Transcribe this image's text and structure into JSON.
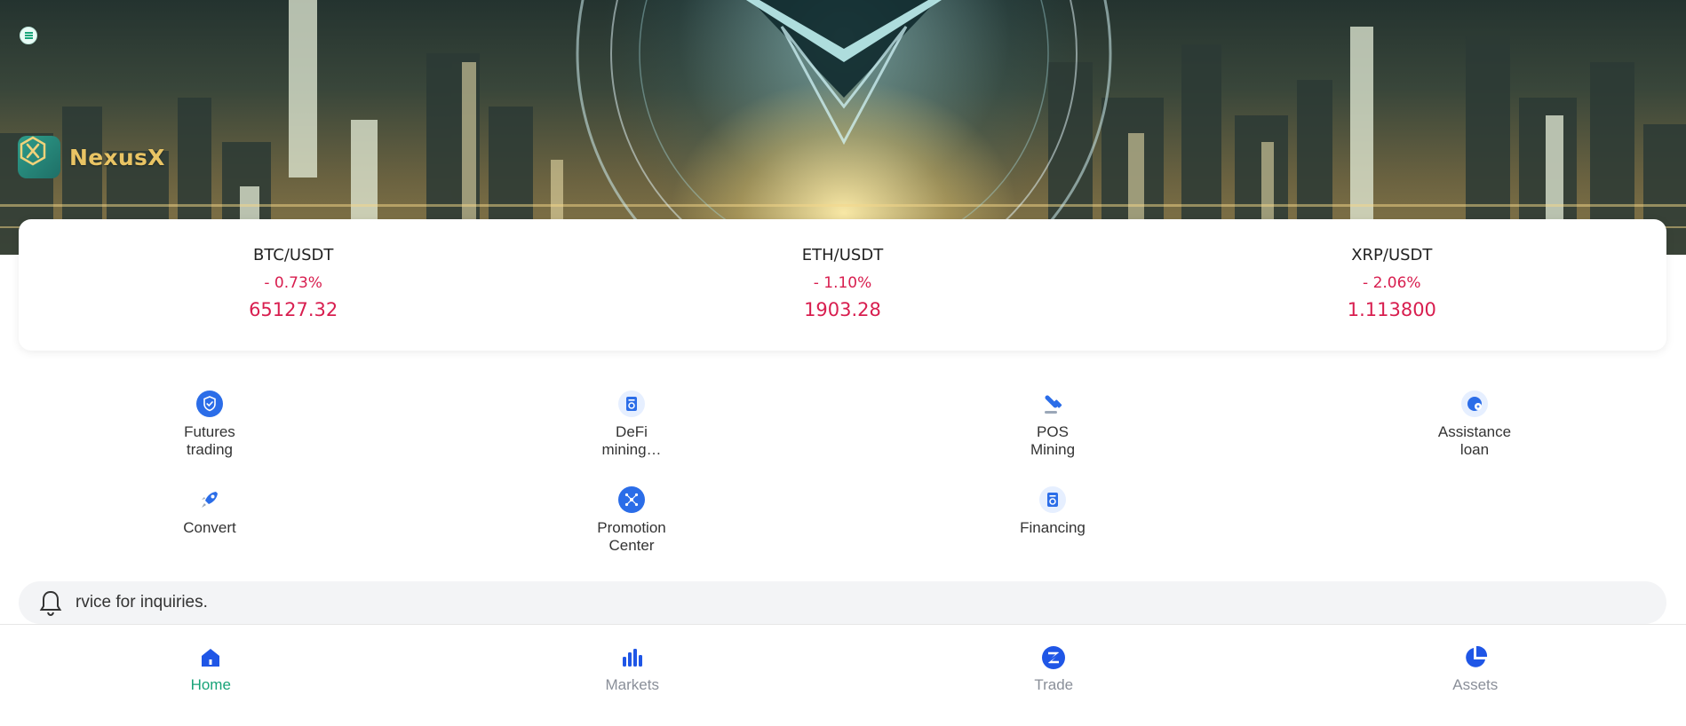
{
  "brand": {
    "name": "NexusX"
  },
  "tickers": [
    {
      "pair": "BTC/USDT",
      "change": "- 0.73%",
      "price": "65127.32"
    },
    {
      "pair": "ETH/USDT",
      "change": "- 1.10%",
      "price": "1903.28"
    },
    {
      "pair": "XRP/USDT",
      "change": "- 2.06%",
      "price": "1.113800"
    }
  ],
  "features": [
    {
      "line1": "Futures",
      "line2": "trading",
      "icon": "shield-check-icon"
    },
    {
      "line1": "DeFi",
      "line2": "mining…",
      "icon": "wallet-doc-icon"
    },
    {
      "line1": "POS",
      "line2": "Mining",
      "icon": "pickaxe-icon"
    },
    {
      "line1": "Assistance",
      "line2": "loan",
      "icon": "loan-coin-icon"
    },
    {
      "line1": "Convert",
      "line2": "",
      "icon": "rocket-icon"
    },
    {
      "line1": "Promotion",
      "line2": "Center",
      "icon": "network-icon"
    },
    {
      "line1": "Financing",
      "line2": "",
      "icon": "financing-doc-icon"
    }
  ],
  "notice": {
    "text": "rvice for inquiries."
  },
  "nav": [
    {
      "label": "Home",
      "icon": "home-icon",
      "active": true
    },
    {
      "label": "Markets",
      "icon": "bar-chart-icon",
      "active": false
    },
    {
      "label": "Trade",
      "icon": "trade-icon",
      "active": false
    },
    {
      "label": "Assets",
      "icon": "pie-chart-icon",
      "active": false
    }
  ],
  "colors": {
    "accent_green": "#17a378",
    "negative_red": "#d81e4f",
    "icon_blue": "#2b6de8",
    "brand_gold": "#e9c464"
  }
}
